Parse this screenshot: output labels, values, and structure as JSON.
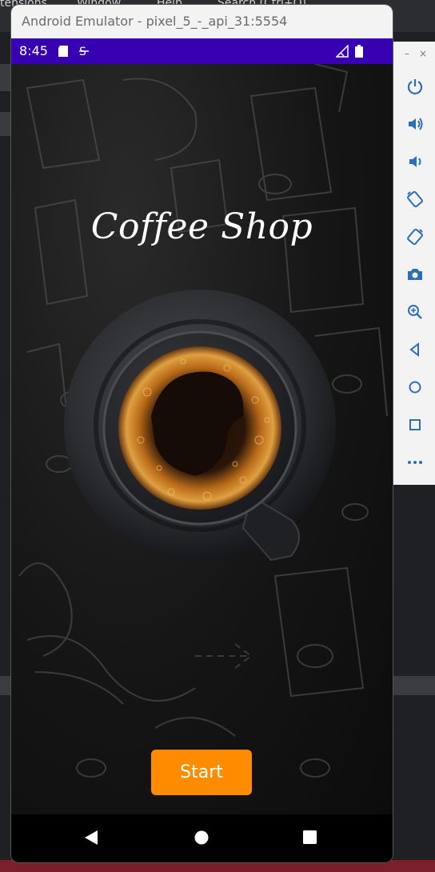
{
  "ide": {
    "menu_items": [
      "tensions",
      "Window",
      "Help",
      "Search (Ctrl+Q)"
    ]
  },
  "emulator": {
    "window_title": "Android Emulator - pixel_5_-_api_31:5554",
    "toolbar": {
      "minimize": "–",
      "close": "×",
      "buttons": [
        "power-icon",
        "volume-up-icon",
        "volume-down-icon",
        "rotate-left-icon",
        "rotate-right-icon",
        "camera-icon",
        "zoom-icon",
        "back-icon",
        "home-icon",
        "overview-icon",
        "more-icon"
      ]
    }
  },
  "statusbar": {
    "time": "8:45"
  },
  "app": {
    "title": "Coffee Shop",
    "start_button": "Start",
    "accent_color": "#ff8c00",
    "status_bar_color": "#3700b3"
  }
}
